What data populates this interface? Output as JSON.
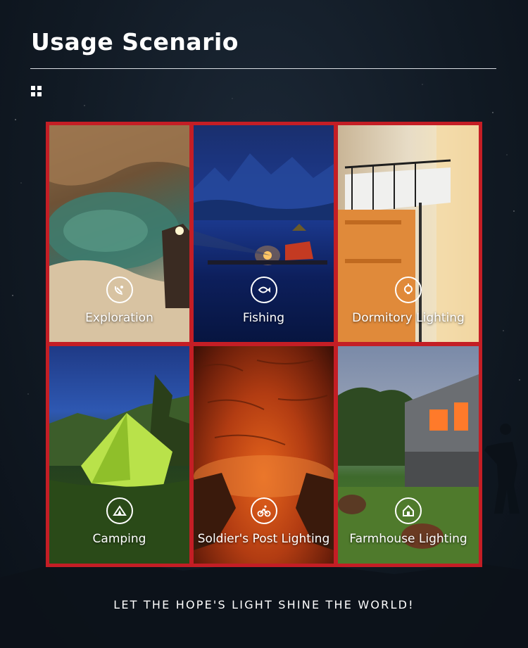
{
  "header": {
    "title": "Usage Scenario"
  },
  "scenarios": [
    {
      "label": "Exploration",
      "icon": "satellite-dish-icon"
    },
    {
      "label": "Fishing",
      "icon": "fish-icon"
    },
    {
      "label": "Dormitory Lighting",
      "icon": "bulb-icon"
    },
    {
      "label": "Camping",
      "icon": "tent-icon"
    },
    {
      "label": "Soldier's Post Lighting",
      "icon": "cyclist-icon"
    },
    {
      "label": "Farmhouse Lighting",
      "icon": "house-icon"
    }
  ],
  "footer": {
    "tagline": "LET THE HOPE'S LIGHT SHINE THE WORLD!"
  },
  "colors": {
    "background": "#111a24",
    "frame": "#c41e25",
    "text": "#ffffff"
  }
}
